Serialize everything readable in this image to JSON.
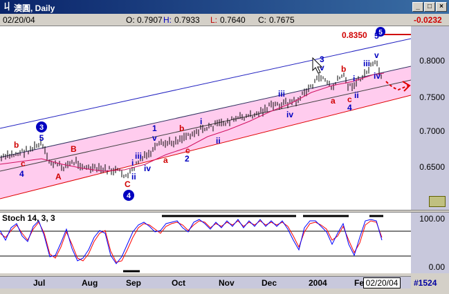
{
  "window": {
    "app_icon_glyph": "丩",
    "title": "澳圓, Daily",
    "minimize": "_",
    "maximize": "□",
    "close": "×"
  },
  "info": {
    "date": "02/20/04",
    "open_label": "O:",
    "open": "0.7907",
    "high_label": "H:",
    "high": "0.7933",
    "low_label": "L:",
    "low": "0.7640",
    "close_label": "C:",
    "close": "0.7675",
    "change": "-0.0232"
  },
  "price_scale": {
    "ticks": [
      "0.8000",
      "0.7500",
      "0.7000",
      "0.6500"
    ],
    "target_label": "0.8350"
  },
  "stoch": {
    "title": "Stoch 14, 3, 3",
    "ticks": [
      "100.00",
      "0.00"
    ]
  },
  "date_axis": {
    "months": [
      "Jul",
      "Aug",
      "Sep",
      "Oct",
      "Nov",
      "Dec",
      "2004",
      "Fe"
    ],
    "cursor_date": "02/20/04",
    "bar_count": "#1524"
  },
  "wave_labels": {
    "blue_3_circle": "3",
    "blue_4_circle": "4",
    "blue_5a": "5",
    "blue_4a": "4",
    "b1": "b",
    "c1": "c",
    "B": "B",
    "A": "A",
    "C": "C",
    "i1": "i",
    "ii1": "ii",
    "iii1": "iii",
    "iv1": "iv",
    "v1": "v",
    "one": "1",
    "a2": "a",
    "b2": "b",
    "c2": "c",
    "two": "2",
    "i2": "i",
    "ii2": "ii",
    "iii2": "iii",
    "iv2": "iv",
    "three": "3",
    "v2": "v",
    "a3": "a",
    "b3": "b",
    "c3": "c",
    "four": "4",
    "i3": "i",
    "ii3": "ii",
    "iii3": "iii",
    "iv3": "iv",
    "v3": "v",
    "five": "5",
    "five_circle": "5"
  },
  "colors": {
    "channel_fill": "#ffccee",
    "upper_line": "#2020c0",
    "lower_line": "#e00000",
    "ma_line": "#d01060",
    "wave_blue": "#0000c0",
    "wave_red": "#d00000",
    "stoch_k": "#0000ff",
    "stoch_d": "#ff0000"
  }
}
